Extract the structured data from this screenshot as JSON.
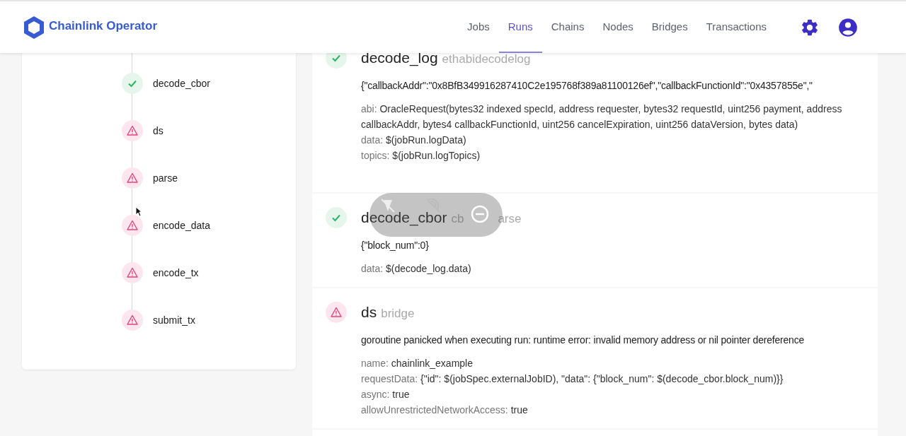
{
  "header": {
    "brand": "Chainlink Operator",
    "nav": [
      {
        "label": "Jobs",
        "selected": false
      },
      {
        "label": "Runs",
        "selected": true
      },
      {
        "label": "Chains",
        "selected": false
      },
      {
        "label": "Nodes",
        "selected": false
      },
      {
        "label": "Bridges",
        "selected": false
      },
      {
        "label": "Transactions",
        "selected": false
      }
    ]
  },
  "task_tree": [
    {
      "name": "decode_cbor",
      "kind": "success"
    },
    {
      "name": "ds",
      "kind": "error"
    },
    {
      "name": "parse",
      "kind": "error"
    },
    {
      "name": "encode_data",
      "kind": "error"
    },
    {
      "name": "encode_tx",
      "kind": "error"
    },
    {
      "name": "submit_tx",
      "kind": "error"
    }
  ],
  "task_runs": [
    {
      "name": "decode_log",
      "type": "ethabidecodelog",
      "kind": "success",
      "output": "{\"callbackAddr\":\"0x8BfB349916287410C2e195768f389a81100126ef\",\"callbackFunctionId\":\"0x4357855e\",\"",
      "params": [
        {
          "key": "abi:",
          "value": "OracleRequest(bytes32 indexed specId, address requester, bytes32 requestId, uint256 payment, address callbackAddr, bytes4 callbackFunctionId, uint256 cancelExpiration, uint256 dataVersion, bytes data)"
        },
        {
          "key": "data:",
          "value": "$(jobRun.logData)"
        },
        {
          "key": "topics:",
          "value": "$(jobRun.logTopics)"
        }
      ]
    },
    {
      "name": "decode_cbor",
      "type": [
        "cb",
        "arse"
      ],
      "kind": "success",
      "output": "{\"block_num\":0}",
      "params": [
        {
          "key": "data:",
          "value": "$(decode_log.data)"
        }
      ]
    },
    {
      "name": "ds",
      "type": "bridge",
      "kind": "error",
      "output": "goroutine panicked when executing run: runtime error: invalid memory address or nil pointer dereference",
      "params": [
        {
          "key": "name:",
          "value": "chainlink_example"
        },
        {
          "key": "requestData:",
          "value": "{\"id\": $(jobSpec.externalJobID), \"data\": {\"block_num\": $(decode_cbor.block_num)}}"
        },
        {
          "key": "async:",
          "value": "true"
        },
        {
          "key": "allowUnrestrictedNetworkAccess:",
          "value": "true"
        }
      ]
    }
  ]
}
